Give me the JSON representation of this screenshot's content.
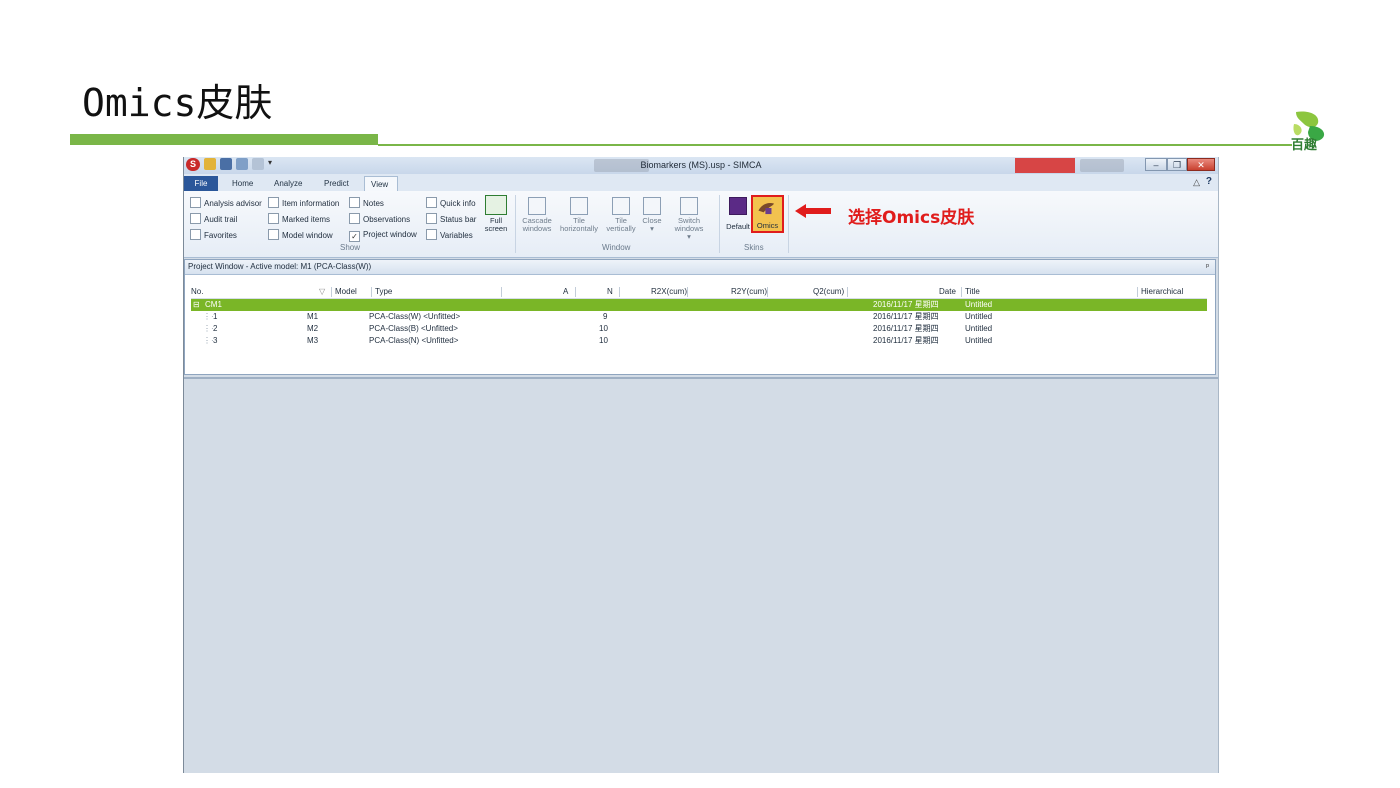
{
  "slide": {
    "title": "Omics皮肤",
    "logo_text": "百趣"
  },
  "window": {
    "title": "Biomarkers (MS).usp - SIMCA",
    "app_icon_letter": "S",
    "controls": {
      "minimize": "–",
      "restore": "❐",
      "close": "✕"
    }
  },
  "tabs": [
    {
      "label": "File"
    },
    {
      "label": "Home"
    },
    {
      "label": "Analyze"
    },
    {
      "label": "Predict"
    },
    {
      "label": "View"
    }
  ],
  "ribbon": {
    "collapse_glyph": "△",
    "help_glyph": "?",
    "show_group": {
      "label": "Show",
      "col1": [
        {
          "label": "Analysis advisor",
          "checked": false
        },
        {
          "label": "Audit trail",
          "checked": false
        },
        {
          "label": "Favorites",
          "checked": false
        }
      ],
      "col2": [
        {
          "label": "Item information",
          "checked": false
        },
        {
          "label": "Marked items",
          "checked": false
        },
        {
          "label": "Model window",
          "checked": false
        }
      ],
      "col3": [
        {
          "label": "Notes",
          "checked": false
        },
        {
          "label": "Observations",
          "checked": false
        },
        {
          "label": "Project window",
          "checked": true
        }
      ],
      "col4": [
        {
          "label": "Quick info",
          "checked": false
        },
        {
          "label": "Status bar",
          "checked": false
        },
        {
          "label": "Variables",
          "checked": false
        }
      ],
      "full_screen": {
        "line1": "Full",
        "line2": "screen"
      }
    },
    "window_group": {
      "label": "Window",
      "buttons": [
        {
          "line1": "Cascade",
          "line2": "windows"
        },
        {
          "line1": "Tile",
          "line2": "horizontally"
        },
        {
          "line1": "Tile",
          "line2": "vertically"
        },
        {
          "line1": "Close",
          "line2": "▾"
        },
        {
          "line1": "Switch",
          "line2": "windows ▾"
        }
      ]
    },
    "skins_group": {
      "label": "Skins",
      "default": "Default",
      "omics": "Omics"
    }
  },
  "annotation": {
    "text": "选择Omics皮肤",
    "color": "#e01c1c"
  },
  "project_window": {
    "title": "Project Window - Active model: M1 (PCA-Class(W))",
    "pin_glyph": "ᵖ",
    "columns": [
      "No.",
      "Model",
      "Type",
      "A",
      "N",
      "R2X(cum)",
      "R2Y(cum)",
      "Q2(cum)",
      "Date",
      "Title",
      "Hierarchical"
    ],
    "sort_glyph": "▽",
    "group_row": {
      "no": "CM1",
      "date": "2016/11/17 星期四",
      "title": "Untitled",
      "expander": "⊟"
    },
    "rows": [
      {
        "no": "1",
        "model": "M1",
        "type": "PCA-Class(W) <Unfitted>",
        "n": "9",
        "date": "2016/11/17 星期四",
        "title": "Untitled"
      },
      {
        "no": "2",
        "model": "M2",
        "type": "PCA-Class(B) <Unfitted>",
        "n": "10",
        "date": "2016/11/17 星期四",
        "title": "Untitled"
      },
      {
        "no": "3",
        "model": "M3",
        "type": "PCA-Class(N) <Unfitted>",
        "n": "10",
        "date": "2016/11/17 星期四",
        "title": "Untitled"
      }
    ]
  },
  "colors": {
    "accent_green": "#7ab648",
    "row_highlight": "#7ab627",
    "ribbon_blue": "#2b579a",
    "omics_skin_yellow": "#f2c24f"
  }
}
